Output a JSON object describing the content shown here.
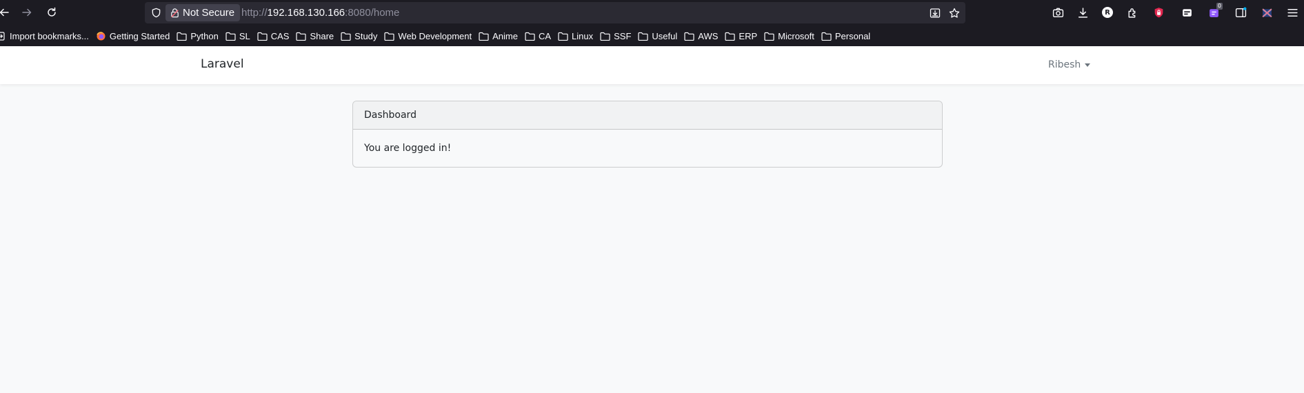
{
  "browser": {
    "security_label": "Not Secure",
    "url": {
      "scheme": "http://",
      "host": "192.168.130.166",
      "rest": ":8080/home"
    },
    "bookmarks": [
      {
        "label": "Import bookmarks...",
        "icon": "import-icon"
      },
      {
        "label": "Getting Started",
        "icon": "firefox-icon"
      },
      {
        "label": "Python",
        "icon": "folder-icon"
      },
      {
        "label": "SL",
        "icon": "folder-icon"
      },
      {
        "label": "CAS",
        "icon": "folder-icon"
      },
      {
        "label": "Share",
        "icon": "folder-icon"
      },
      {
        "label": "Study",
        "icon": "folder-icon"
      },
      {
        "label": "Web Development",
        "icon": "folder-icon"
      },
      {
        "label": "Anime",
        "icon": "folder-icon"
      },
      {
        "label": "CA",
        "icon": "folder-icon"
      },
      {
        "label": "Linux",
        "icon": "folder-icon"
      },
      {
        "label": "SSF",
        "icon": "folder-icon"
      },
      {
        "label": "Useful",
        "icon": "folder-icon"
      },
      {
        "label": "AWS",
        "icon": "folder-icon"
      },
      {
        "label": "ERP",
        "icon": "folder-icon"
      },
      {
        "label": "Microsoft",
        "icon": "folder-icon"
      },
      {
        "label": "Personal",
        "icon": "folder-icon"
      }
    ],
    "toolbar_icons": [
      "back-icon",
      "forward-icon",
      "reload-icon",
      "shield-icon",
      "lock-warning-icon",
      "save-page-icon",
      "bookmark-star-icon",
      "screenshot-icon",
      "downloads-icon",
      "account-r-icon",
      "extensions-icon",
      "red-extension-icon",
      "extension-icon",
      "counter-extension-icon",
      "sidebar-icon",
      "flag-extension-icon",
      "menu-icon"
    ],
    "extension_badge_count": "0",
    "account_initial": "R"
  },
  "app": {
    "brand": "Laravel",
    "user_name": "Ribesh"
  },
  "card": {
    "header": "Dashboard",
    "body": "You are logged in!"
  },
  "colors": {
    "chrome_bg": "#1c1b22",
    "urlbar_bg": "#2b2a33",
    "page_bg": "#f8f9fa",
    "navbar_bg": "#ffffff"
  }
}
